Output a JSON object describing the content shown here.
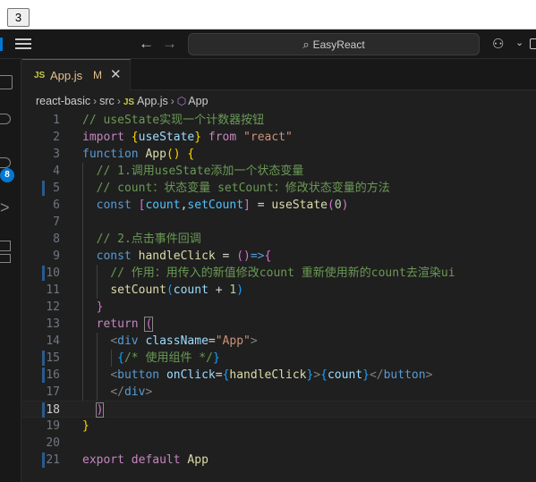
{
  "preview": {
    "counter_value": "3"
  },
  "titlebar": {
    "search_text": "EasyReact",
    "back_glyph": "←",
    "forward_glyph": "→",
    "icons": [
      "menu-icon",
      "search-icon",
      "copilot-icon",
      "layout-icon"
    ]
  },
  "activity_bar": {
    "icons": [
      "explorer-icon",
      "search-icon",
      "source-control-icon",
      "run-debug-icon",
      "extensions-icon"
    ],
    "scm_badge": "8"
  },
  "tab": {
    "badge": "JS",
    "label": "App.js",
    "status": "M",
    "close": "✕"
  },
  "breadcrumb": {
    "items": [
      "react-basic",
      "src",
      "App.js",
      "App"
    ],
    "file_badge": "JS"
  },
  "editor": {
    "active_line": 18,
    "lines": [
      {
        "n": "1",
        "text": "// useState实现一个计数器按钮"
      },
      {
        "n": "2",
        "text": "import {useState} from \"react\""
      },
      {
        "n": "3",
        "text": "function App() {"
      },
      {
        "n": "4",
        "text": "  // 1.调用useState添加一个状态变量"
      },
      {
        "n": "5",
        "text": "  // count：状态变量 setCount：修改状态变量的方法"
      },
      {
        "n": "6",
        "text": "  const [count,setCount] = useState(0)"
      },
      {
        "n": "7",
        "text": ""
      },
      {
        "n": "8",
        "text": "  // 2.点击事件回调"
      },
      {
        "n": "9",
        "text": "  const handleClick = ()=>{"
      },
      {
        "n": "10",
        "text": "    // 作用：用传入的新值修改count 重新使用新的count去渲染ui"
      },
      {
        "n": "11",
        "text": "    setCount(count + 1)"
      },
      {
        "n": "12",
        "text": "  }"
      },
      {
        "n": "13",
        "text": "  return ("
      },
      {
        "n": "14",
        "text": "    <div className=\"App\">"
      },
      {
        "n": "15",
        "text": "     {/* 使用组件 */}"
      },
      {
        "n": "16",
        "text": "    <button onClick={handleClick}>{count}</button>"
      },
      {
        "n": "17",
        "text": "    </div>"
      },
      {
        "n": "18",
        "text": "  )"
      },
      {
        "n": "19",
        "text": "}"
      },
      {
        "n": "20",
        "text": ""
      },
      {
        "n": "21",
        "text": "export default App"
      }
    ]
  },
  "colors": {
    "accent": "#0078d4",
    "comment": "#6a9955",
    "keyword": "#569cd6",
    "control": "#c586c0",
    "function": "#dcdcaa",
    "variable": "#9cdcfe",
    "string": "#ce9178",
    "modified": "#e2c08d"
  }
}
